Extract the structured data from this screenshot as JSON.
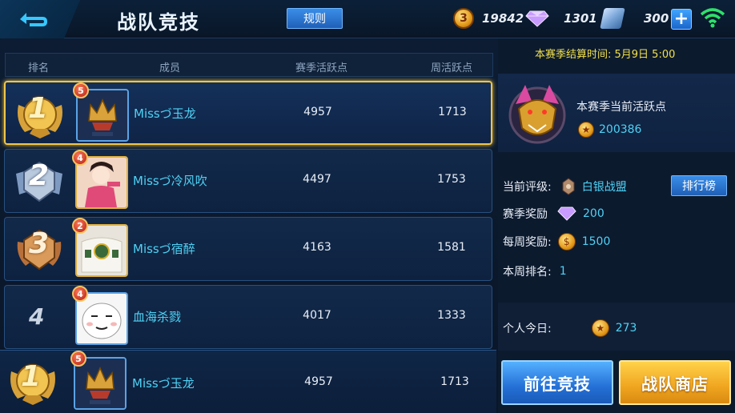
{
  "header": {
    "title": "战队竞技",
    "rules_label": "规则",
    "gold": "19842",
    "diamonds": "1301",
    "vouchers": "300",
    "gold_icon_glyph": "3"
  },
  "table": {
    "headers": {
      "rank": "排名",
      "member": "成员",
      "season": "赛季活跃点",
      "weekly": "周活跃点"
    },
    "rows": [
      {
        "rank": "1",
        "level": "5",
        "member": "Missづ玉龙",
        "season": "4957",
        "weekly": "1713",
        "medal": "gold",
        "active": true
      },
      {
        "rank": "2",
        "level": "4",
        "member": "Missづ冷风吹",
        "season": "4497",
        "weekly": "1753",
        "medal": "silver",
        "active": false
      },
      {
        "rank": "3",
        "level": "2",
        "member": "Missづ宿醉",
        "season": "4163",
        "weekly": "1581",
        "medal": "bronze",
        "active": false
      },
      {
        "rank": "4",
        "level": "4",
        "member": "血海杀戮",
        "season": "4017",
        "weekly": "1333",
        "medal": "none",
        "active": false
      }
    ],
    "mine": {
      "rank": "1",
      "level": "5",
      "member": "Missづ玉龙",
      "season": "4957",
      "weekly": "1713",
      "medal": "gold"
    }
  },
  "panel": {
    "settlement": "本赛季结算时间: 5月9日 5:00",
    "current_label": "本赛季当前活跃点",
    "current_value": "200386",
    "rating_label": "当前评级:",
    "rating_value": "白银战盟",
    "leaderboard_label": "排行榜",
    "season_reward_label": "赛季奖励",
    "season_reward_value": "200",
    "weekly_reward_label": "每周奖励:",
    "weekly_reward_value": "1500",
    "weekly_rank_label": "本周排名:",
    "weekly_rank_value": "1",
    "today_label": "个人今日:",
    "today_value": "273",
    "go_label": "前往竞技",
    "shop_label": "战队商店"
  },
  "colors": {
    "accent": "#4fd2f5",
    "gold": "#f0c64a",
    "settle": "#f0e04a"
  }
}
